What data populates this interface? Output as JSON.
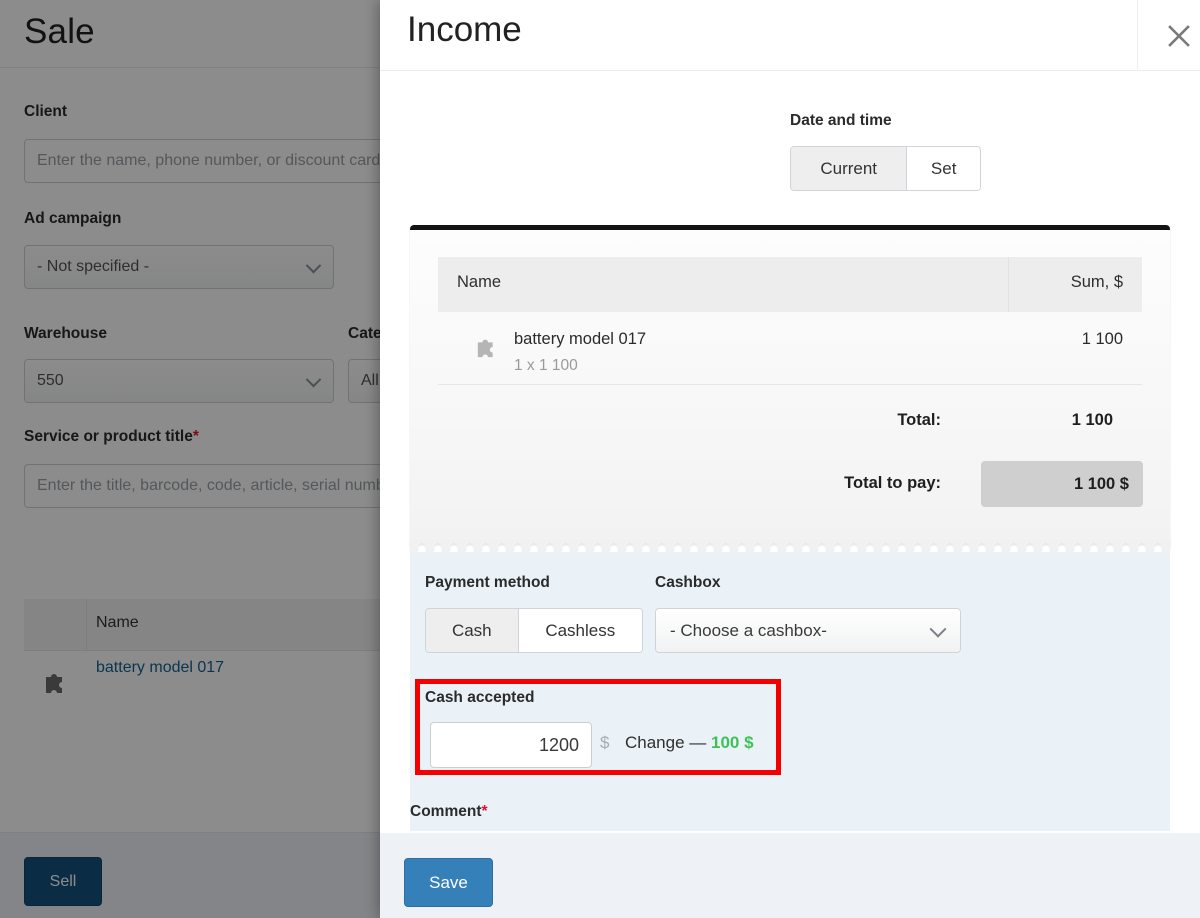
{
  "background": {
    "title": "Sale",
    "fields": [
      {
        "label": "Client",
        "placeholder": "Enter the name, phone number, or discount card number"
      },
      {
        "label": "Ad campaign",
        "value": "- Not specified -"
      },
      {
        "label": "Warehouse",
        "value": "550"
      },
      {
        "label": "Category",
        "value": "All"
      },
      {
        "label": "Service or product title",
        "required": "*",
        "placeholder": "Enter the title, barcode, code, article, serial number"
      }
    ],
    "table": {
      "name_header": "Name",
      "row_link": "battery model 017"
    },
    "sell_button": "Sell"
  },
  "modal": {
    "title": "Income",
    "close_icon": "close-icon",
    "date_time": {
      "label": "Date and time",
      "options": [
        {
          "label": "Current",
          "selected": true
        },
        {
          "label": "Set",
          "selected": false
        }
      ]
    },
    "receipt": {
      "headers": {
        "name": "Name",
        "sum": "Sum, $"
      },
      "items": [
        {
          "title": "battery model 017",
          "qty_line": "1 x 1 100",
          "sum": "1 100",
          "icon": "puzzle-piece-icon"
        }
      ],
      "total_label": "Total:",
      "total_value": "1 100",
      "total_to_pay_label": "Total to pay:",
      "total_to_pay_value": "1 100 $"
    },
    "payment": {
      "method_label": "Payment method",
      "method_options": [
        {
          "label": "Cash",
          "selected": true
        },
        {
          "label": "Cashless",
          "selected": false
        }
      ],
      "cashbox_label": "Cashbox",
      "cashbox_value": "- Choose a cashbox-",
      "cash_accepted_label": "Cash accepted",
      "cash_accepted_value": "1200",
      "currency_symbol": "$",
      "change_prefix": "Change — ",
      "change_value": "100 $",
      "change_color": "#3ec257",
      "highlight_color": "#f40000"
    },
    "comment_label": "Comment",
    "comment_required": "*",
    "save_button": "Save"
  }
}
